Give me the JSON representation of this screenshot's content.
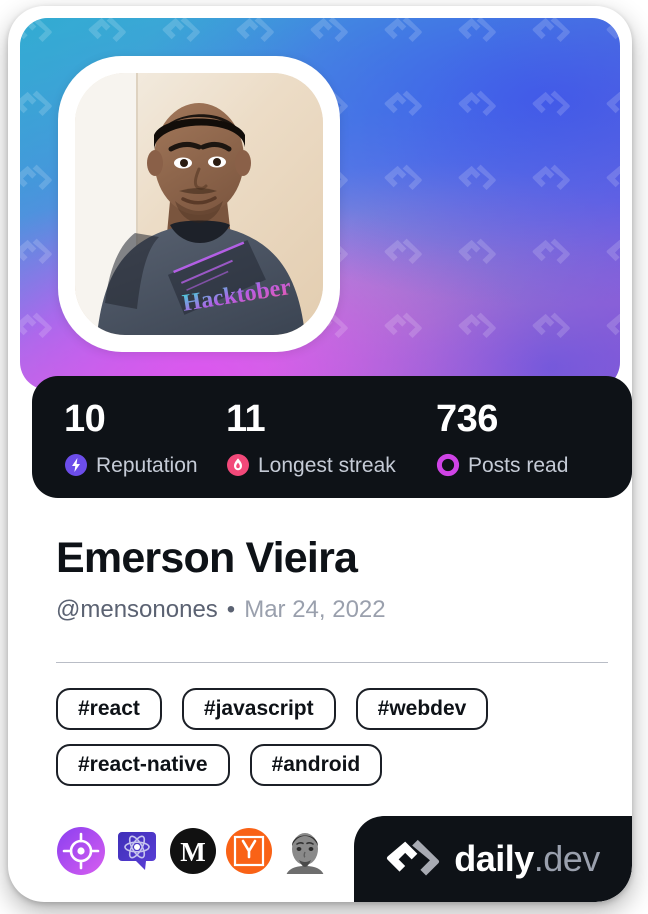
{
  "card": {
    "accent_dark": "#0e1217",
    "cover_gradient_from": "#3fa8d8",
    "cover_gradient_to": "#e06fd4"
  },
  "avatar": {
    "alt": "Emerson Vieira profile photo"
  },
  "stats": [
    {
      "value": "10",
      "label": "Reputation",
      "icon": "lightning-bolt-icon",
      "color": "#6c4dea"
    },
    {
      "value": "11",
      "label": "Longest streak",
      "icon": "flame-icon",
      "color": "#f2497a"
    },
    {
      "value": "736",
      "label": "Posts read",
      "icon": "ring-icon",
      "color": "#cf43e6"
    }
  ],
  "identity": {
    "name": "Emerson Vieira",
    "handle": "@mensonones",
    "separator": "•",
    "joined": "Mar 24, 2022"
  },
  "tags": [
    "#react",
    "#javascript",
    "#webdev",
    "#react-native",
    "#android"
  ],
  "sources": [
    {
      "name": "source-target-icon",
      "title": "daily.dev source"
    },
    {
      "name": "source-react-icon",
      "title": "React"
    },
    {
      "name": "source-medium-icon",
      "title": "Medium"
    },
    {
      "name": "source-hackernews-icon",
      "title": "Hacker News"
    },
    {
      "name": "source-avatar-icon",
      "title": "Author avatar"
    }
  ],
  "brand": {
    "name": "daily",
    "suffix": ".dev",
    "logo": "daily-dev-logo-icon"
  }
}
